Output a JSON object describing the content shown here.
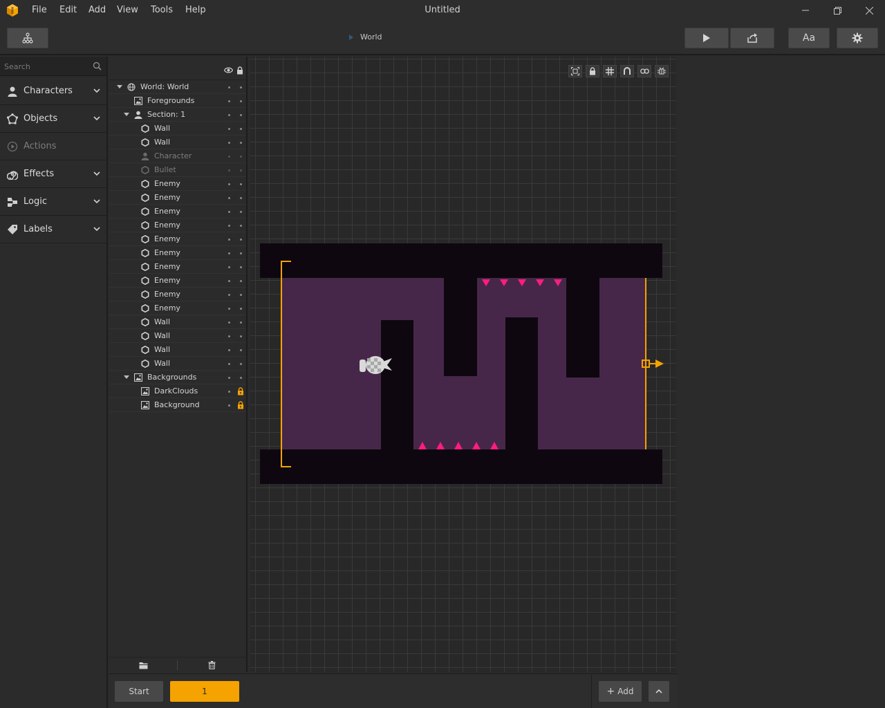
{
  "app": {
    "title": "Untitled"
  },
  "menu": [
    "File",
    "Edit",
    "Add",
    "View",
    "Tools",
    "Help"
  ],
  "toolbar": {
    "breadcrumb": "World",
    "font_button_label": "Aa"
  },
  "sidebar": {
    "search_placeholder": "Search",
    "categories": [
      {
        "label": "Characters",
        "icon": "person-icon",
        "enabled": true
      },
      {
        "label": "Objects",
        "icon": "objects-icon",
        "enabled": true
      },
      {
        "label": "Actions",
        "icon": "play-circle-icon",
        "enabled": false
      },
      {
        "label": "Effects",
        "icon": "spiral-icon",
        "enabled": true
      },
      {
        "label": "Logic",
        "icon": "logic-icon",
        "enabled": true
      },
      {
        "label": "Labels",
        "icon": "tag-icon",
        "enabled": true
      }
    ]
  },
  "outline": {
    "items": [
      {
        "label": "World: World",
        "icon": "globe-icon",
        "depth": 0,
        "expanded": true,
        "dim": false,
        "locked": false
      },
      {
        "label": "Foregrounds",
        "icon": "image-icon",
        "depth": 1,
        "expanded": null,
        "dim": false,
        "locked": false
      },
      {
        "label": "Section: 1",
        "icon": "person-icon",
        "depth": 1,
        "expanded": true,
        "dim": false,
        "locked": false
      },
      {
        "label": "Wall",
        "icon": "hexagon-icon",
        "depth": 2,
        "dim": false,
        "locked": false
      },
      {
        "label": "Wall",
        "icon": "hexagon-icon",
        "depth": 2,
        "dim": false,
        "locked": false
      },
      {
        "label": "Character",
        "icon": "person-icon",
        "depth": 2,
        "dim": true,
        "locked": false
      },
      {
        "label": "Bullet",
        "icon": "hexagon-icon",
        "depth": 2,
        "dim": true,
        "locked": false
      },
      {
        "label": "Enemy",
        "icon": "hexagon-icon",
        "depth": 2,
        "dim": false,
        "locked": false
      },
      {
        "label": "Enemy",
        "icon": "hexagon-icon",
        "depth": 2,
        "dim": false,
        "locked": false
      },
      {
        "label": "Enemy",
        "icon": "hexagon-icon",
        "depth": 2,
        "dim": false,
        "locked": false
      },
      {
        "label": "Enemy",
        "icon": "hexagon-icon",
        "depth": 2,
        "dim": false,
        "locked": false
      },
      {
        "label": "Enemy",
        "icon": "hexagon-icon",
        "depth": 2,
        "dim": false,
        "locked": false
      },
      {
        "label": "Enemy",
        "icon": "hexagon-icon",
        "depth": 2,
        "dim": false,
        "locked": false
      },
      {
        "label": "Enemy",
        "icon": "hexagon-icon",
        "depth": 2,
        "dim": false,
        "locked": false
      },
      {
        "label": "Enemy",
        "icon": "hexagon-icon",
        "depth": 2,
        "dim": false,
        "locked": false
      },
      {
        "label": "Enemy",
        "icon": "hexagon-icon",
        "depth": 2,
        "dim": false,
        "locked": false
      },
      {
        "label": "Enemy",
        "icon": "hexagon-icon",
        "depth": 2,
        "dim": false,
        "locked": false
      },
      {
        "label": "Wall",
        "icon": "hexagon-icon",
        "depth": 2,
        "dim": false,
        "locked": false
      },
      {
        "label": "Wall",
        "icon": "hexagon-icon",
        "depth": 2,
        "dim": false,
        "locked": false
      },
      {
        "label": "Wall",
        "icon": "hexagon-icon",
        "depth": 2,
        "dim": false,
        "locked": false
      },
      {
        "label": "Wall",
        "icon": "hexagon-icon",
        "depth": 2,
        "dim": false,
        "locked": false
      },
      {
        "label": "Backgrounds",
        "icon": "image-icon",
        "depth": 1,
        "expanded": true,
        "dim": false,
        "locked": false
      },
      {
        "label": "DarkClouds",
        "icon": "image-icon",
        "depth": 2,
        "dim": false,
        "locked": true
      },
      {
        "label": "Background",
        "icon": "image-icon",
        "depth": 2,
        "dim": false,
        "locked": true
      }
    ]
  },
  "canvas_tools": [
    "fit-icon",
    "lock-icon",
    "grid-icon",
    "magnet-icon",
    "link-icon",
    "debug-icon"
  ],
  "scenes": {
    "start_label": "Start",
    "active_label": "1",
    "add_label": "Add"
  },
  "colors": {
    "accent": "#f5a300",
    "level_bg": "#472749",
    "wall": "#0e0710",
    "spike": "#ff1c7d"
  }
}
